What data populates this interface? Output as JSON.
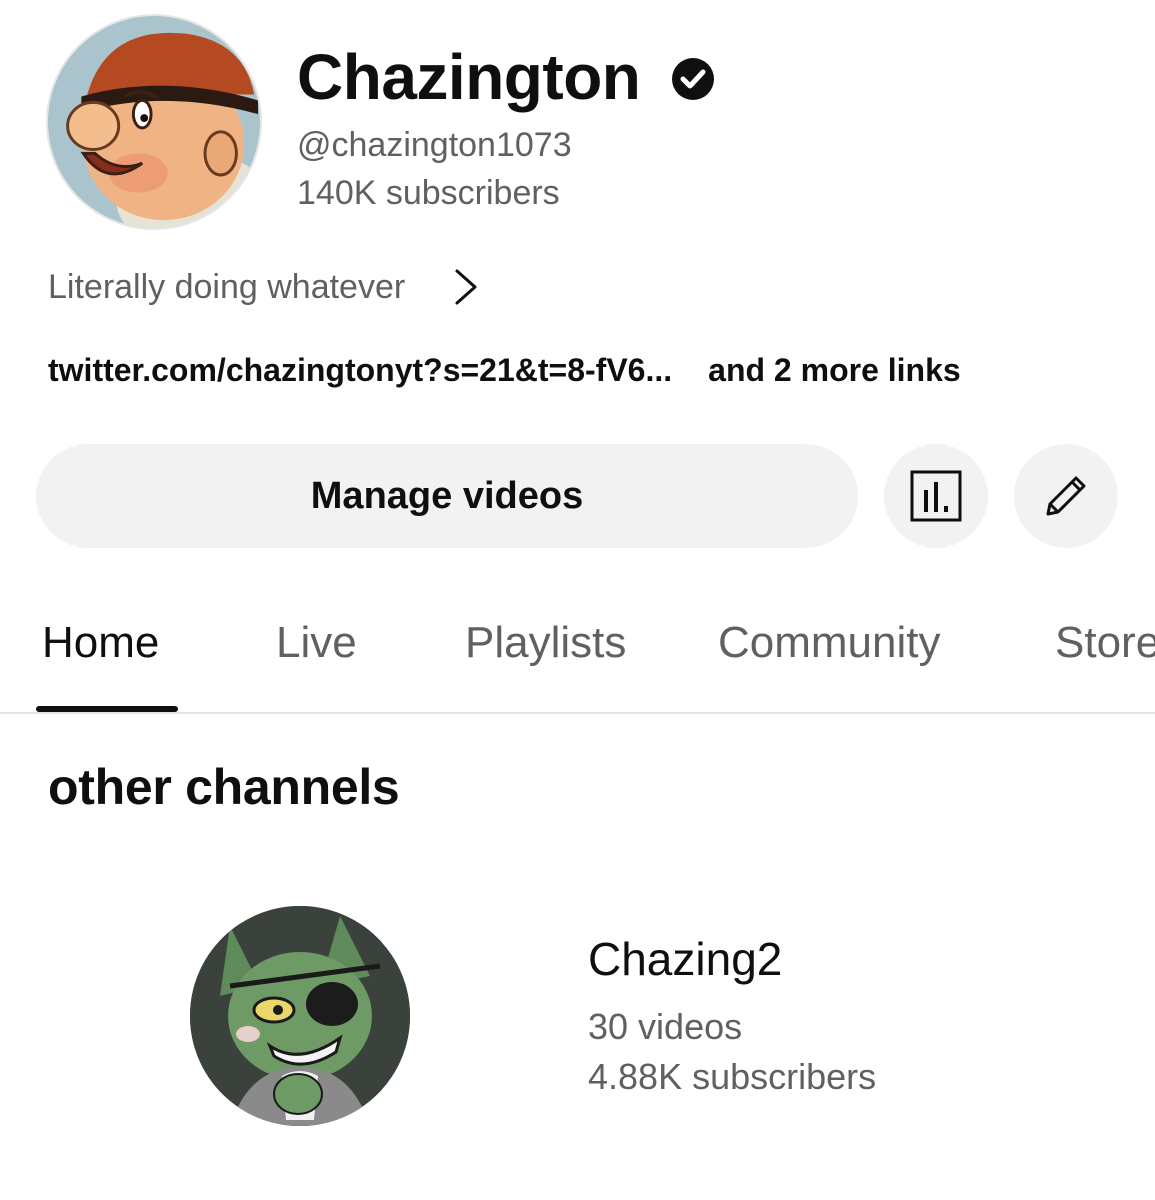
{
  "channel": {
    "name": "Chazington",
    "handle": "@chazington1073",
    "subscribers": "140K subscribers",
    "verified_icon": "verified-check-icon",
    "description": "Literally doing whatever",
    "primary_link": "twitter.com/chazingtonyt?s=21&t=8-fV6...",
    "more_links": "and 2 more links"
  },
  "actions": {
    "manage_label": "Manage videos",
    "analytics_icon": "analytics-icon",
    "edit_icon": "pencil-icon"
  },
  "tabs": [
    {
      "label": "Home",
      "active": true
    },
    {
      "label": "Live",
      "active": false
    },
    {
      "label": "Playlists",
      "active": false
    },
    {
      "label": "Community",
      "active": false
    },
    {
      "label": "Store",
      "active": false
    }
  ],
  "section": {
    "title": "other channels",
    "channels": [
      {
        "name": "Chazing2",
        "videos": "30 videos",
        "subscribers": "4.88K subscribers"
      }
    ]
  },
  "colors": {
    "text_primary": "#0f0f0f",
    "text_secondary": "#606060",
    "button_bg": "#f2f2f2",
    "divider": "#e5e5e5"
  }
}
